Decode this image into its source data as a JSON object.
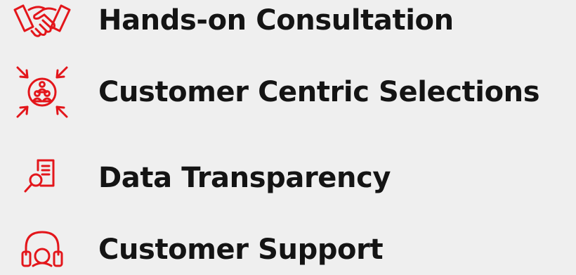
{
  "accent_color": "#e3161b",
  "features": [
    {
      "label": "Hands-on Consultation",
      "icon": "handshake-icon"
    },
    {
      "label": "Customer Centric Selections",
      "icon": "customer-centric-icon"
    },
    {
      "label": "Data Transparency",
      "icon": "document-search-icon"
    },
    {
      "label": "Customer Support",
      "icon": "headset-icon"
    }
  ]
}
